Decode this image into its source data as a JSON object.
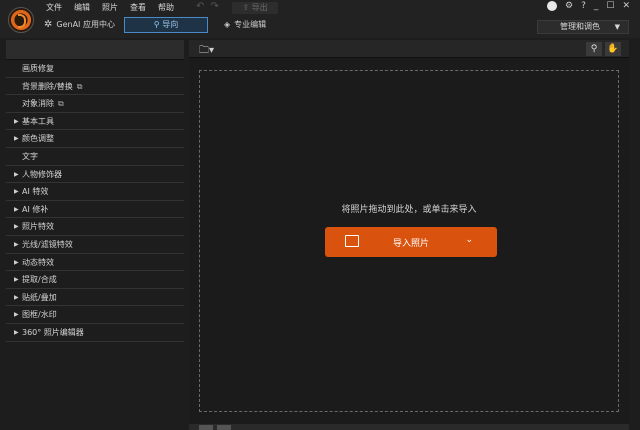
{
  "app": {
    "menu": [
      "文件",
      "编辑",
      "照片",
      "查看",
      "帮助"
    ],
    "export_label": "导出",
    "genai_label": "GenAI 应用中心",
    "tab_guide": "导向",
    "tab_pro": "专业编辑",
    "manage_label": "管理和调色",
    "window_controls": [
      "?",
      "_",
      "☐",
      "✕"
    ]
  },
  "sidebar": {
    "items": [
      {
        "label": "画质修复",
        "expandable": false,
        "external": false
      },
      {
        "label": "背景删除/替换",
        "expandable": false,
        "external": true
      },
      {
        "label": "对象消除",
        "expandable": false,
        "external": true
      },
      {
        "label": "基本工具",
        "expandable": true,
        "external": false
      },
      {
        "label": "颜色调整",
        "expandable": true,
        "external": false
      },
      {
        "label": "文字",
        "expandable": false,
        "external": false
      },
      {
        "label": "人物修饰器",
        "expandable": true,
        "external": false
      },
      {
        "label": "AI 特效",
        "expandable": true,
        "external": false
      },
      {
        "label": "AI 修补",
        "expandable": true,
        "external": false
      },
      {
        "label": "照片特效",
        "expandable": true,
        "external": false
      },
      {
        "label": "光线/滤镜特效",
        "expandable": true,
        "external": false
      },
      {
        "label": "动态特效",
        "expandable": true,
        "external": false
      },
      {
        "label": "提取/合成",
        "expandable": true,
        "external": false
      },
      {
        "label": "贴纸/叠加",
        "expandable": true,
        "external": false
      },
      {
        "label": "图框/水印",
        "expandable": true,
        "external": false
      },
      {
        "label": "360° 照片编辑器",
        "expandable": true,
        "external": false
      }
    ]
  },
  "main": {
    "drop_text": "将照片拖动到此处，或单击来导入",
    "import_label": "导入照片"
  },
  "colors": {
    "accent_orange": "#d9530f",
    "tab_blue": "#4a8ac8"
  }
}
